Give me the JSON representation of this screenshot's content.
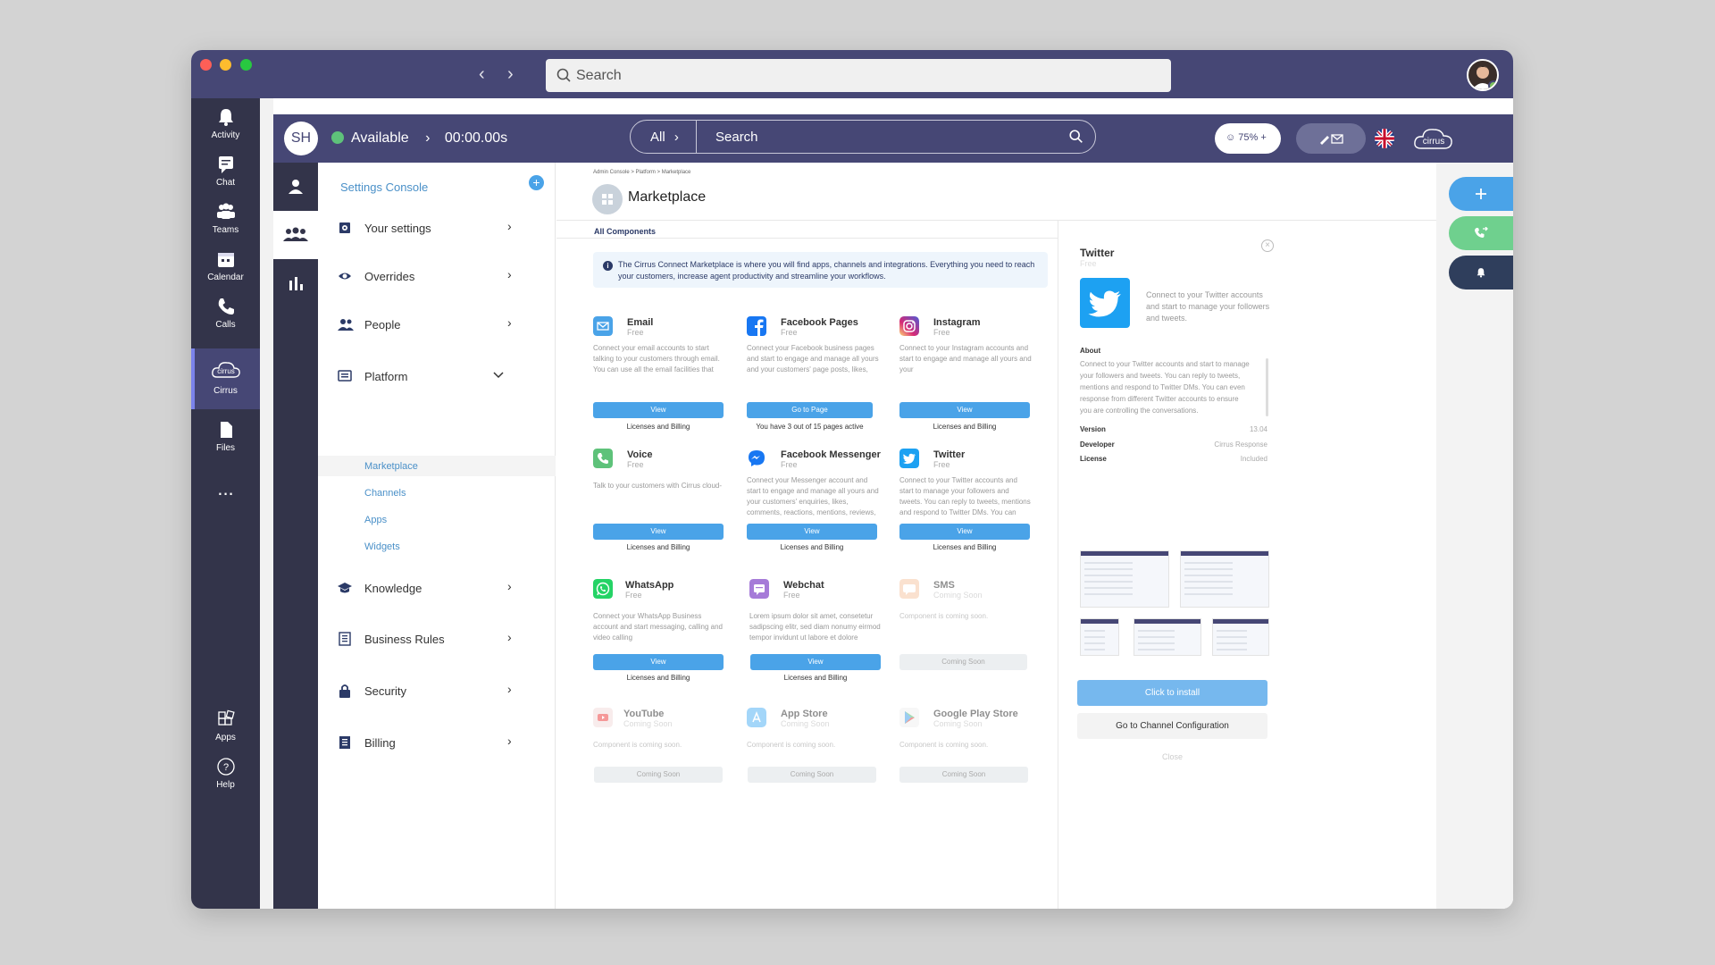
{
  "titlebar": {
    "search_placeholder": "Search"
  },
  "teams_rail": {
    "items": [
      {
        "label": "Activity"
      },
      {
        "label": "Chat"
      },
      {
        "label": "Teams"
      },
      {
        "label": "Calendar"
      },
      {
        "label": "Calls"
      },
      {
        "label": "Cirrus",
        "active": true
      },
      {
        "label": "Files"
      },
      {
        "label": "..."
      }
    ],
    "bottom": [
      {
        "label": "Apps"
      },
      {
        "label": "Help"
      }
    ]
  },
  "header": {
    "initials": "SH",
    "status": "Available",
    "timer": "00:00.00s",
    "filter": "All",
    "search": "Search",
    "quality": "75%",
    "brand": "cirrus"
  },
  "sidebar": {
    "title": "Settings Console",
    "items": [
      {
        "label": "Your settings",
        "icon": "gear-icon"
      },
      {
        "label": "Overrides",
        "icon": "eye-icon"
      },
      {
        "label": "People",
        "icon": "people-icon"
      },
      {
        "label": "Platform",
        "icon": "platform-icon",
        "expanded": true
      },
      {
        "label": "Knowledge",
        "icon": "graduation-cap-icon"
      },
      {
        "label": "Business Rules",
        "icon": "list-icon"
      },
      {
        "label": "Security",
        "icon": "lock-icon"
      },
      {
        "label": "Billing",
        "icon": "billing-icon"
      }
    ],
    "platform_sub": [
      "Marketplace",
      "Channels",
      "Apps",
      "Widgets"
    ]
  },
  "main": {
    "breadcrumb": "Admin Console > Platform > Marketplace",
    "title": "Marketplace",
    "tab": "All Components",
    "info": "The Cirrus Connect Marketplace is where you will find apps, channels and integrations. Everything you need to reach your customers, increase agent productivity and streamline your workflows.",
    "cards": [
      {
        "name": "Email",
        "price": "Free",
        "desc": "Connect your email accounts to start talking to your customers through email. You can use all the email facilities that you would expect in an",
        "button": "View",
        "footer": "Licenses and Billing"
      },
      {
        "name": "Facebook Pages",
        "price": "Free",
        "desc": "Connect your Facebook business pages and start to engage and manage all yours and your customers' page posts, likes, comments, reactions, mentions, reviews, Messenger",
        "button": "Go to Page",
        "footer": "You have 3 out of 15 pages active"
      },
      {
        "name": "Instagram",
        "price": "Free",
        "desc": "Connect to your Instagram accounts and start to engage and manage all yours and your",
        "button": "View",
        "footer": "Licenses and Billing"
      },
      {
        "name": "Voice",
        "price": "Free",
        "desc": "Talk to your customers with Cirrus cloud-",
        "button": "View",
        "footer": "Licenses and Billing"
      },
      {
        "name": "Facebook Messenger",
        "price": "Free",
        "desc": "Connect your Messenger account and start to engage and manage all yours and your customers' enquiries, likes, comments, reactions, mentions, reviews, Messenger",
        "button": "View",
        "footer": "Licenses and Billing"
      },
      {
        "name": "Twitter",
        "price": "Free",
        "desc": "Connect to your Twitter accounts and start to manage your followers and tweets. You can reply to tweets, mentions and respond to Twitter DMs. You can even response from",
        "button": "View",
        "footer": "Licenses and Billing"
      },
      {
        "name": "WhatsApp",
        "price": "Free",
        "desc": "Connect your WhatsApp Business account and start messaging, calling and video calling",
        "button": "View",
        "footer": "Licenses and Billing"
      },
      {
        "name": "Webchat",
        "price": "Free",
        "desc": "Lorem ipsum dolor sit amet, consetetur sadipscing elitr, sed diam nonumy eirmod tempor invidunt ut labore et dolore magna",
        "button": "View",
        "footer": "Licenses and Billing"
      },
      {
        "name": "SMS",
        "price": "Coming Soon",
        "desc": "Component is coming soon.",
        "button": "Coming Soon",
        "footer": ""
      },
      {
        "name": "YouTube",
        "price": "Coming Soon",
        "desc": "Component is coming soon.",
        "button": "Coming Soon",
        "footer": ""
      },
      {
        "name": "App Store",
        "price": "Coming Soon",
        "desc": "Component is coming soon.",
        "button": "Coming Soon",
        "footer": ""
      },
      {
        "name": "Google Play Store",
        "price": "Coming Soon",
        "desc": "Component is coming soon.",
        "button": "Coming Soon",
        "footer": ""
      }
    ]
  },
  "panel": {
    "title": "Twitter",
    "price": "Free",
    "short": "Connect to your Twitter accounts and start to manage your followers and tweets.",
    "about_label": "About",
    "about": "Connect to your Twitter accounts and start to manage your followers and tweets. You can reply to tweets, mentions and respond to Twitter DMs. You can even response from different Twitter accounts to ensure you are controlling the conversations.",
    "version_label": "Version",
    "version": "13.04",
    "developer_label": "Developer",
    "developer": "Cirrus Response",
    "license_label": "License",
    "license": "Included",
    "install": "Click to install",
    "config": "Go to Channel Configuration",
    "close": "Close"
  },
  "colors": {
    "accent": "#4aa3e8",
    "header": "#464775",
    "rail": "#33344a",
    "available": "#5ec27a"
  }
}
